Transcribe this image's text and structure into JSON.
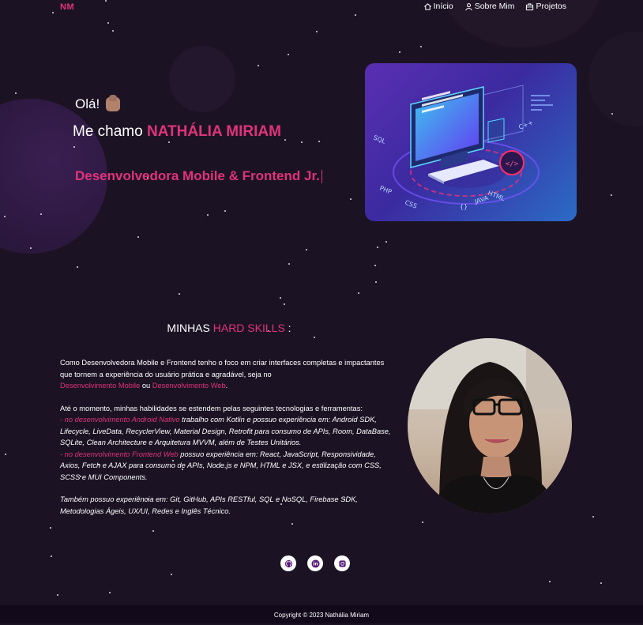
{
  "nav": {
    "logo": "NM",
    "items": [
      {
        "label": "Início",
        "icon": "home-icon"
      },
      {
        "label": "Sobre Mim",
        "icon": "user-icon"
      },
      {
        "label": "Projetos",
        "icon": "briefcase-icon"
      }
    ]
  },
  "hero": {
    "greeting": "Olá!",
    "greeting_emoji": "waving-hand-icon",
    "intro_prefix": "Me chamo",
    "name": "NATHÁLIA MIRIAM",
    "role": "Desenvolvedora Mobile & Frontend Jr.",
    "image_labels": [
      "SQL",
      "PHP",
      "CSS",
      "C++",
      "HTML",
      "JAVA",
      "{}",
      "</>"
    ]
  },
  "hard_skills": {
    "title_prefix": "MINHAS",
    "title_highlight": "HARD SKILLS",
    "title_suffix": " :",
    "p1_text": "Como Desenvolvedora Mobile e Frontend tenho o foco em criar interfaces completas e impactantes que tornem a experiência do usuário prática e agradável, seja no",
    "p1_link1": "Desenvolvimento Mobile",
    "p1_or": " ou ",
    "p1_link2": "Desenvolvimento Web",
    "p1_end": ".",
    "p2_intro": "Até o momento, minhas habilidades se estendem pelas seguintes tecnologias e ferramentas:",
    "android_label": "- no desenvolvimento Android Nativo",
    "android_text": " trabalho com Kotlin e possuo experiência em: Android SDK, Lifecycle, LiveData, RecyclerView, Material Design, Retrofit para consumo de APIs, Room, DataBase, SQLite, Clean Architecture e Arquitetura MVVM, além de Testes Unitários.",
    "web_label": "- no desenvolvimento Frontend Web",
    "web_text": " possuo experiência em: React, JavaScript, Responsividade, Axios, Fetch e AJAX para consumo de APIs, Node.js e NPM, HTML e JSX, e estilização com CSS, SCSS e MUI Components.",
    "p3": "Também possuo experiência em: Git, GitHub, APIs RESTful, SQL e NoSQL, Firebase SDK, Metodologias Ágeis, UX/UI, Redes e Inglês Técnico."
  },
  "socials": [
    {
      "name": "github-icon"
    },
    {
      "name": "linkedin-icon"
    },
    {
      "name": "instagram-icon"
    }
  ],
  "footer": {
    "copyright": "Copyright © 2023 Nathália Miriam"
  },
  "colors": {
    "background": "#1b1323",
    "accent": "#e0337a",
    "footer_bg": "#12091a"
  }
}
